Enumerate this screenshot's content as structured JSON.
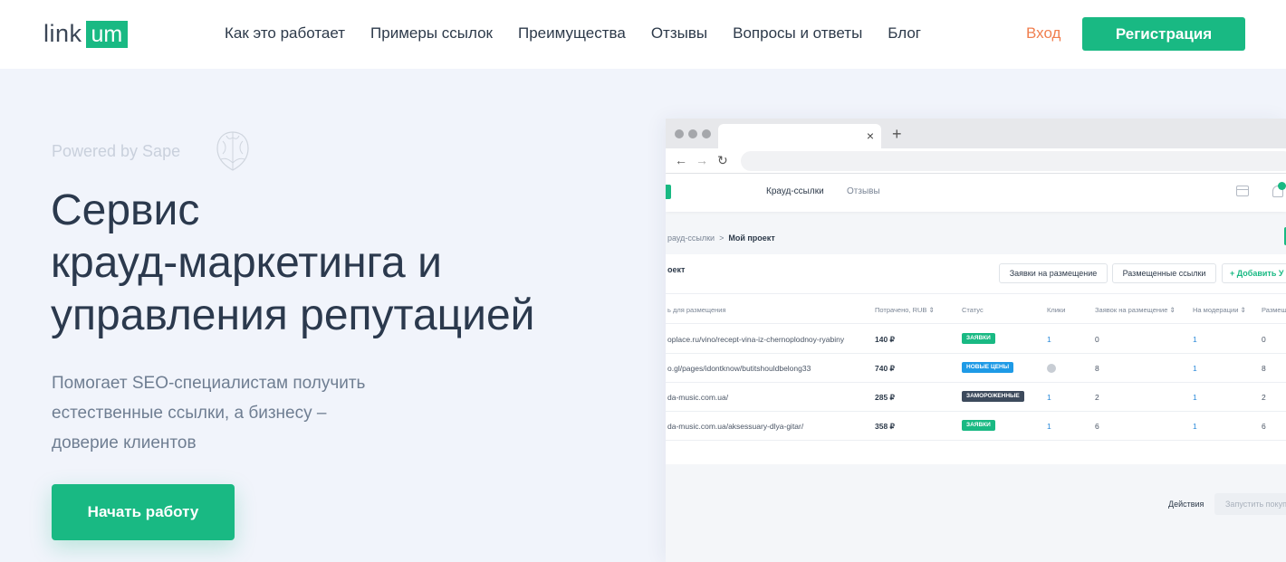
{
  "header": {
    "logo_text": "link",
    "logo_badge": "um",
    "nav": [
      "Как это работает",
      "Примеры ссылок",
      "Преимущества",
      "Отзывы",
      "Вопросы и ответы",
      "Блог"
    ],
    "login": "Вход",
    "register": "Регистрация"
  },
  "hero": {
    "powered_by": "Powered by Sape",
    "title_lines": [
      "Сервис",
      "крауд-маркетинга и",
      "управления репутацией"
    ],
    "subtitle_lines": [
      "Помогает SEO-специалистам получить",
      "естественные ссылки, а бизнесу –",
      "доверие клиентов"
    ],
    "cta": "Начать работу"
  },
  "mockup": {
    "tab_close": "×",
    "tab_plus": "+",
    "app_nav": [
      "Крауд-ссылки",
      "Отзывы"
    ],
    "breadcrumb": {
      "parent": "рауд-ссылки",
      "separator": ">",
      "current": "Мой проект"
    },
    "panel_title": "оект",
    "buttons": {
      "requests": "Заявки на размещение",
      "placed": "Размещенные ссылки",
      "add": "Добавить У"
    },
    "table": {
      "headers": [
        "ь для размещения",
        "Потрачено, RUB ⇕",
        "Статус",
        "Клики",
        "Заявок на размещение ⇕",
        "На модерации ⇕",
        "Размещ"
      ],
      "rows": [
        {
          "url": "oplace.ru/vino/recept-vina-iz-chernoplodnoy-ryabiny",
          "spent": "140 ₽",
          "status": "ЗАЯВКИ",
          "status_color": "#19b983",
          "clicks": "1",
          "requests": "0",
          "moderation": "1",
          "placed": "0"
        },
        {
          "url": "o.gl/pages/idontknow/butitshouldbelong33",
          "spent": "740 ₽",
          "status": "НОВЫЕ ЦЕНЫ",
          "status_color": "#1e9ae6",
          "clicks": "",
          "requests": "8",
          "moderation": "1",
          "placed": "8"
        },
        {
          "url": "da-music.com.ua/",
          "spent": "285 ₽",
          "status": "ЗАМОРОЖЕННЫЕ",
          "status_color": "#3d4a5c",
          "clicks": "1",
          "requests": "2",
          "moderation": "1",
          "placed": "2"
        },
        {
          "url": "da-music.com.ua/aksessuary-dlya-gitar/",
          "spent": "358 ₽",
          "status": "ЗАЯВКИ",
          "status_color": "#19b983",
          "clicks": "1",
          "requests": "6",
          "moderation": "1",
          "placed": "6"
        }
      ]
    },
    "actions_label": "Действия",
    "run_button": "Запустить покуп"
  }
}
